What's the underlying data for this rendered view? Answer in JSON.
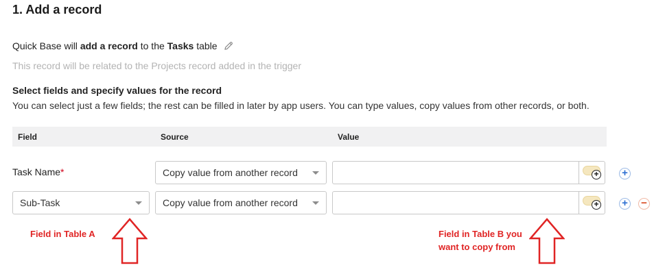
{
  "section": {
    "title": "1. Add a record"
  },
  "summary": {
    "prefix": "Quick Base will ",
    "action": "add a record",
    "middle": " to the ",
    "table": "Tasks",
    "suffix": " table",
    "related_note": "This record will be related to the Projects record added in the trigger"
  },
  "fields_section": {
    "heading": "Select fields and specify values for the record",
    "description": "You can select just a few fields; the rest can be filled in later by app users. You can type values, copy values from other records, or both."
  },
  "table": {
    "headers": {
      "field": "Field",
      "source": "Source",
      "value": "Value"
    },
    "rows": [
      {
        "field": "Task Name",
        "required_marker": "*",
        "source": "Copy value from another record",
        "value": ""
      },
      {
        "field": "Sub-Task",
        "source": "Copy value from another record",
        "value": ""
      }
    ]
  },
  "buttons": {
    "add": "+",
    "remove": "−",
    "toggle_plus": "+"
  },
  "annotations": {
    "table_a": "Field in Table A",
    "table_b_line1": "Field in Table B you",
    "table_b_line2": "want to copy from"
  },
  "icons": {
    "edit": "pencil-icon",
    "caret": "chevron-down-icon",
    "arrow": "arrow-up-icon"
  },
  "colors": {
    "annotation": "#e02424",
    "add_button": "#2d6fd2",
    "remove_button": "#d8481f",
    "toggle": "#f5e7bf",
    "header_bg": "#f1f1f2"
  }
}
